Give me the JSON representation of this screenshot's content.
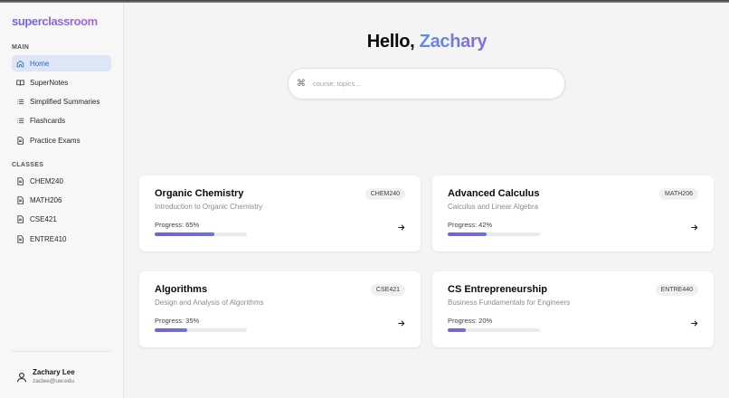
{
  "app": {
    "logo": "superclassroom"
  },
  "sidebar": {
    "main_label": "MAIN",
    "main_items": [
      {
        "label": "Home",
        "icon": "home-icon",
        "active": true
      },
      {
        "label": "SuperNotes",
        "icon": "book-icon",
        "active": false
      },
      {
        "label": "Simplified Summaries",
        "icon": "list-icon",
        "active": false
      },
      {
        "label": "Flashcards",
        "icon": "list-icon",
        "active": false
      },
      {
        "label": "Practice Exams",
        "icon": "document-icon",
        "active": false
      }
    ],
    "classes_label": "CLASSES",
    "class_items": [
      {
        "label": "CHEM240",
        "icon": "document-icon"
      },
      {
        "label": "MATH206",
        "icon": "document-icon"
      },
      {
        "label": "CSE421",
        "icon": "document-icon"
      },
      {
        "label": "ENTRE410",
        "icon": "document-icon"
      }
    ],
    "user": {
      "name": "Zachary Lee",
      "email": "zaclee@uw.edu",
      "icon": "user-icon"
    }
  },
  "main": {
    "greeting_prefix": "Hello,",
    "greeting_name": "Zachary",
    "search": {
      "placeholder": "course: topics...",
      "value": "",
      "icon": "command-icon"
    },
    "courses": [
      {
        "title": "Organic Chemistry",
        "subtitle": "Introduction to Organic Chemistry",
        "code": "CHEM240",
        "progress_label": "Progress: 65%",
        "progress": 65
      },
      {
        "title": "Advanced Calculus",
        "subtitle": "Calculus and Linear Algebra",
        "code": "MATH206",
        "progress_label": "Progress: 42%",
        "progress": 42
      },
      {
        "title": "Algorithms",
        "subtitle": "Design and Analysis of Algorithms",
        "code": "CSE421",
        "progress_label": "Progress: 35%",
        "progress": 35
      },
      {
        "title": "CS Entrepreneurship",
        "subtitle": "Business Fundamentals for Engineers",
        "code": "ENTRE440",
        "progress_label": "Progress: 20%",
        "progress": 20
      }
    ]
  },
  "colors": {
    "accent": "#2b63c4",
    "active_bg": "#dde6f7",
    "progress_fill": "#7c5bd9"
  }
}
